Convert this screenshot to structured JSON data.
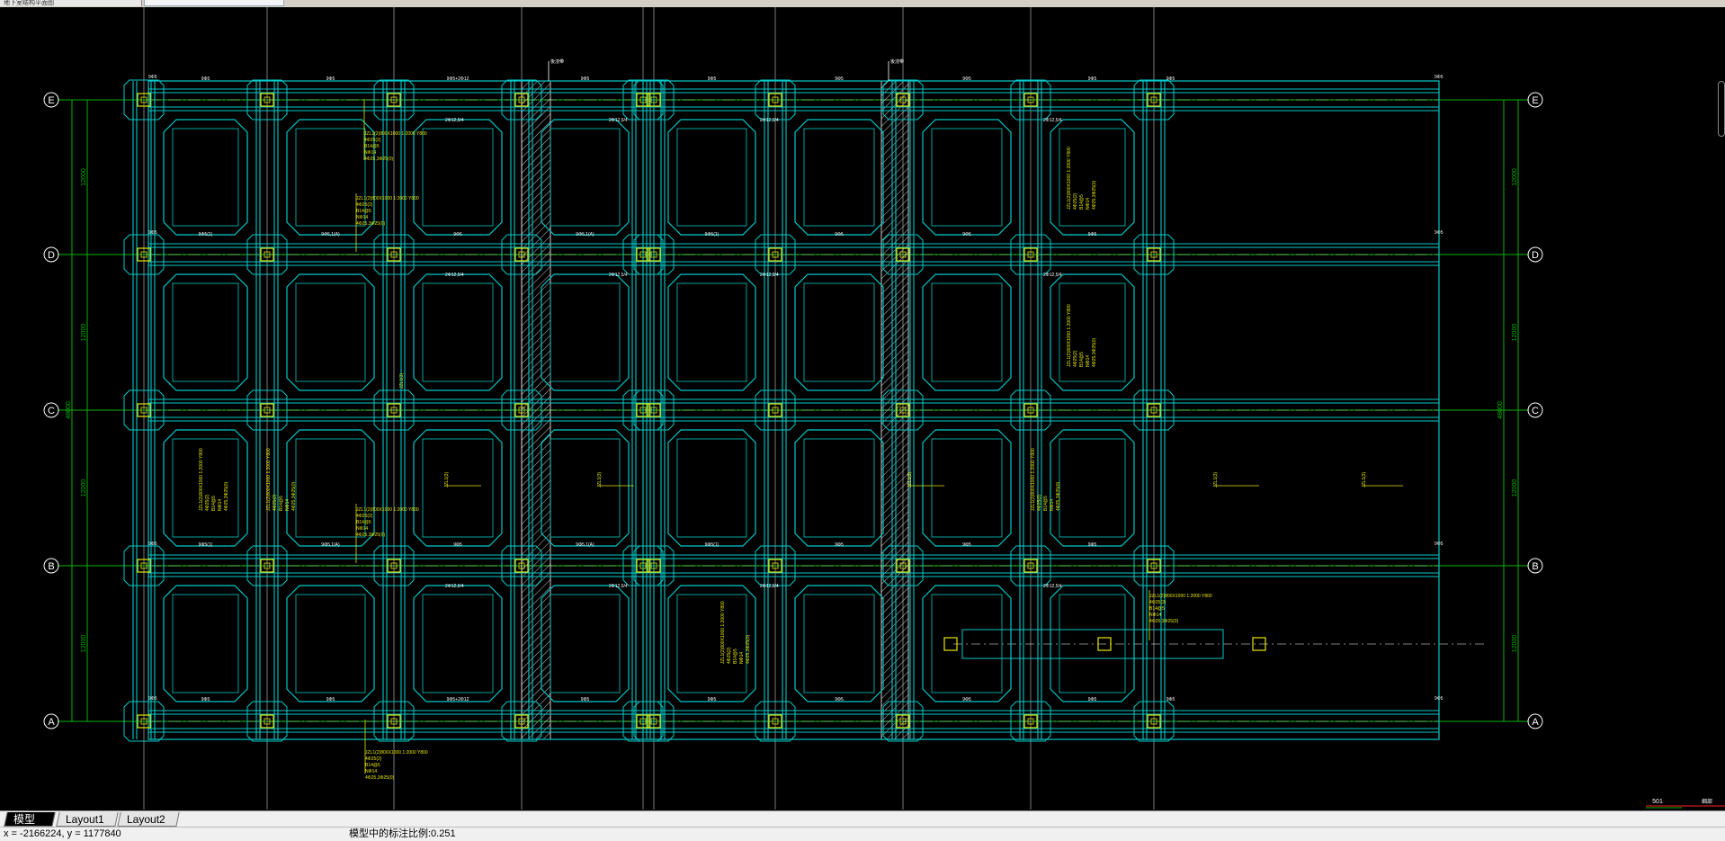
{
  "window": {
    "doc_tab_title": "地下室结构平面图"
  },
  "tabs": [
    {
      "label": "模型",
      "active": true
    },
    {
      "label": "Layout1",
      "active": false
    },
    {
      "label": "Layout2",
      "active": false
    }
  ],
  "status": {
    "coords": "x = -2166224, y = 1177840",
    "annotation_scale": "模型中的标注比例:0.251"
  },
  "drawing": {
    "grid_rows": [
      "E",
      "D",
      "C",
      "B",
      "A"
    ],
    "row_dim": "12000",
    "total_dim": "48000",
    "top_span_labels": [
      "9Φ5",
      "9Φ5",
      "9Φ5+2Φ12",
      "9Φ5",
      "9Φ5",
      "9Φ5",
      "9Φ5",
      "9Φ5",
      "9Φ5"
    ],
    "mid_span_labels": [
      "9Φ5(1)",
      "9Φ5,1(A)",
      "9Φ5",
      "9Φ5,1(A)",
      "9Φ5(1)",
      "9Φ5",
      "9Φ5",
      "9Φ5"
    ],
    "corner_labels": [
      "2Φ12,5/4",
      "2Φ12,5/4",
      "2Φ12,5/4",
      "2Φ12,5/4"
    ],
    "side_label": "9Φ5",
    "pointer_labels": [
      "後浇带",
      "後浇带"
    ],
    "note_lines": [
      "JZL1(2)800X1000 1:2000 Y800",
      "4Φ25(2)",
      "B14@5",
      "NΦ14",
      "4Φ25,3Φ25(0)"
    ],
    "single_note": "JZL1(3)",
    "scale_bar": {
      "value": "501",
      "label": "细部"
    },
    "colors": {
      "beam": "#00c8c8",
      "axis": "#00b400",
      "annotation": "#e6e600",
      "frame": "#ffffff",
      "hatch": "#c8c8c8"
    }
  }
}
